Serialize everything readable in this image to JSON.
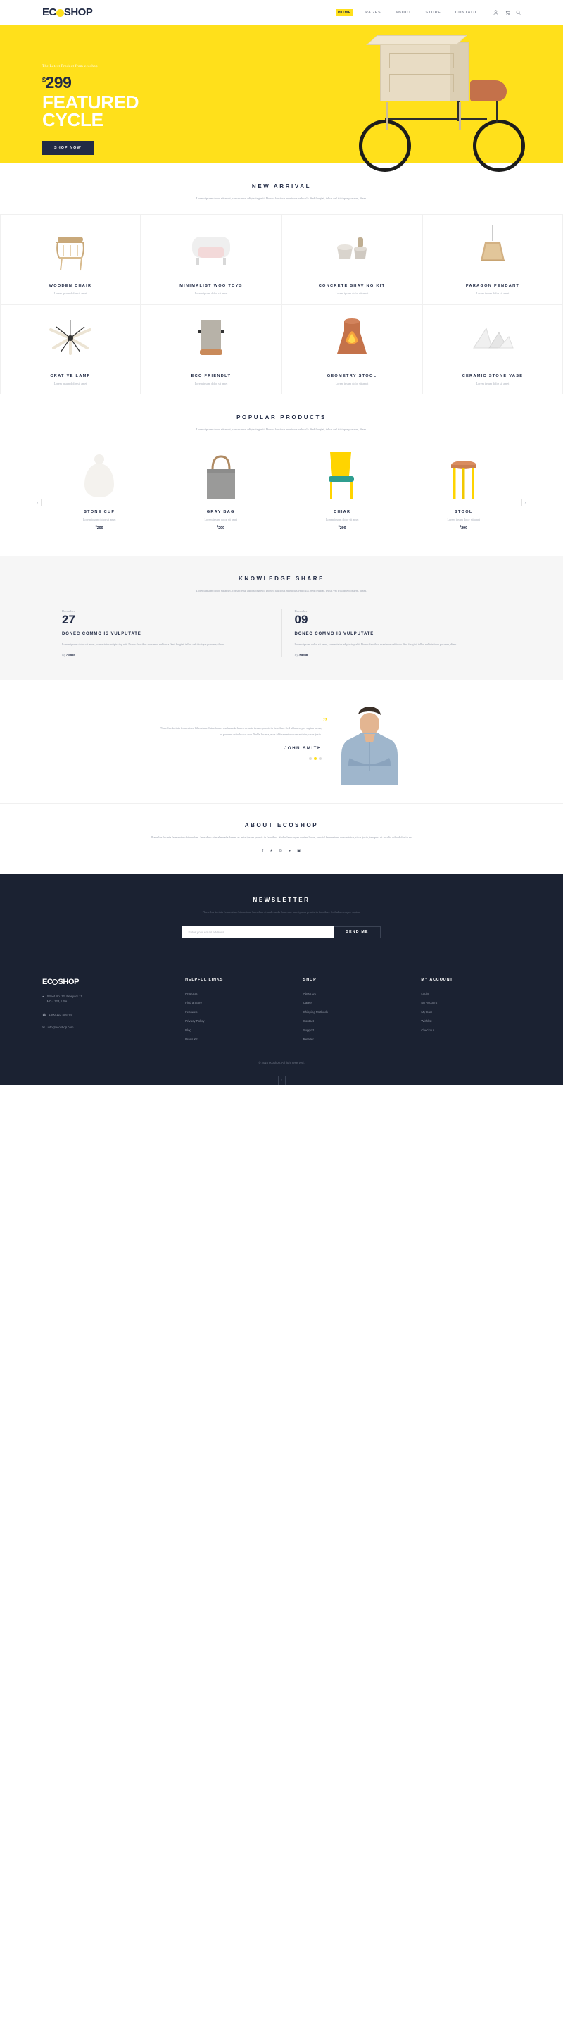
{
  "brand": {
    "name_before": "EC",
    "name_circle": "O",
    "name_after": "SHOP"
  },
  "nav": {
    "items": [
      {
        "label": "HOME",
        "active": true
      },
      {
        "label": "PAGES",
        "active": false
      },
      {
        "label": "ABOUT",
        "active": false
      },
      {
        "label": "STORE",
        "active": false
      },
      {
        "label": "CONTACT",
        "active": false
      }
    ],
    "icons": [
      "user-icon",
      "cart-icon",
      "search-icon"
    ]
  },
  "hero": {
    "kicker": "The Latest Product from ecoshop",
    "currency": "$",
    "price": "299",
    "title_line1": "FEATURED",
    "title_line2": "CYCLE",
    "button": "SHOP NOW",
    "bg_color": "#ffe01b"
  },
  "new_arrival": {
    "title": "NEW ARRIVAL",
    "subtitle": "Lorem ipsum dolor sit amet, consectetur adipiscing elit. Donec faucibus maximus vehicula. Sed feugiat, tellus vel tristique posuere, diam.",
    "items": [
      {
        "name": "WOODEN CHAIR",
        "desc": "Lorem ipsum dolor sit amet"
      },
      {
        "name": "MINIMALIST WOO TOYS",
        "desc": "Lorem ipsum dolor sit amet"
      },
      {
        "name": "CONCRETE SHAVING KIT",
        "desc": "Lorem ipsum dolor sit amet"
      },
      {
        "name": "PARAGON PENDANT",
        "desc": "Lorem ipsum dolor sit amet"
      },
      {
        "name": "CRATIVE LAMP",
        "desc": "Lorem ipsum dolor sit amet"
      },
      {
        "name": "ECO FRIENDLY",
        "desc": "Lorem ipsum dolor sit amet"
      },
      {
        "name": "GEOMETRY STOOL",
        "desc": "Lorem ipsum dolor sit amet"
      },
      {
        "name": "CERAMIC STONE VASE",
        "desc": "Lorem ipsum dolor sit amet"
      }
    ]
  },
  "popular": {
    "title": "POPULAR PRODUCTS",
    "subtitle": "Lorem ipsum dolor sit amet, consectetur adipiscing elit. Donec faucibus maximus vehicula. Sed feugiat, tellus vel tristique posuere, diam.",
    "prev": "‹",
    "next": "›",
    "items": [
      {
        "name": "STONE CUP",
        "desc": "Lorem ipsum dolor sit amet",
        "currency": "$",
        "price": "299"
      },
      {
        "name": "GRAY BAG",
        "desc": "Lorem ipsum dolor sit amet",
        "currency": "$",
        "price": "299"
      },
      {
        "name": "CHIAR",
        "desc": "Lorem ipsum dolor sit amet",
        "currency": "$",
        "price": "299"
      },
      {
        "name": "STOOL",
        "desc": "Lorem ipsum dolor sit amet",
        "currency": "$",
        "price": "299"
      }
    ]
  },
  "knowledge": {
    "title": "KNOWLEDGE SHARE",
    "subtitle": "Lorem ipsum dolor sit amet, consectetur adipiscing elit. Donec faucibus maximus vehicula. Sed feugiat, tellus vel tristique posuere, diam.",
    "posts": [
      {
        "month": "December",
        "day": "27",
        "title": "DONEC COMMO IS VULPUTATE",
        "text": "Lorem ipsum dolor sit amet, consectetur adipiscing elit. Donec faucibus maximus vehicula. Sed feugiat, tellus vel tristique posuere, diam.",
        "by_prefix": "By ",
        "author": "Admin"
      },
      {
        "month": "December",
        "day": "09",
        "title": "DONEC COMMO IS VULPUTATE",
        "text": "Lorem ipsum dolor sit amet, consectetur adipiscing elit. Donec faucibus maximus vehicula. Sed feugiat, tellus vel tristique posuere, diam.",
        "by_prefix": "By ",
        "author": "Admin"
      }
    ]
  },
  "testimonial": {
    "quote_mark": "”",
    "text": "Phasellus lacinia fermentum bibendum. Interdum et malesuada fames ac ante ipsum primis in faucibus. Sed ullamcorper sapien lacus, eu posuere odio luctus non. Nulla lacinia, eros id fermentum consectetur, risus justo.",
    "name": "JOHN SMITH",
    "dots": 3,
    "active_dot": 1
  },
  "about": {
    "title": "ABOUT ECOSHOP",
    "text": "Phasellus lacinia fermentum bibendum. Interdum et malesuada fames ac ante ipsum primis in faucibus. Sed ullamcorper sapien lacus, eros id fermentum consectetur, risus justo, tempus, ut iaculis odio dolor in ex.",
    "socials": [
      "facebook-icon",
      "twitter-icon",
      "behance-icon",
      "dribbble-icon",
      "instagram-icon"
    ]
  },
  "newsletter": {
    "title": "NEWSLETTER",
    "subtitle": "Phasellus lacinia fermentum bibendum. Interdum et malesuada fames ac ante ipsum primis in faucibus. Sed ullamcorper sapien.",
    "input_placeholder": "Enter your email address",
    "input_value": "",
    "button": "SEND ME"
  },
  "footer": {
    "address_line1": "Street No. 12, Newyork 11",
    "address_line2": "MD - 123, USA.",
    "phone": "1800 123 456789",
    "email": "info@ecoshop.com",
    "columns": [
      {
        "head": "HELPFUL LINKS",
        "links": [
          "Products",
          "Find a Store",
          "Features",
          "Privacy Policy",
          "Blog",
          "Press Kit"
        ]
      },
      {
        "head": "SHOP",
        "links": [
          "About Us",
          "Career",
          "Shipping Methods",
          "Contact",
          "Support",
          "Retailer"
        ]
      },
      {
        "head": "MY ACCOUNT",
        "links": [
          "Login",
          "My Account",
          "My Cart",
          "Wishlist",
          "Checkout"
        ]
      }
    ],
    "copyright": "© 2016 ecoshop. All right reserved.",
    "to_top": "↑"
  }
}
